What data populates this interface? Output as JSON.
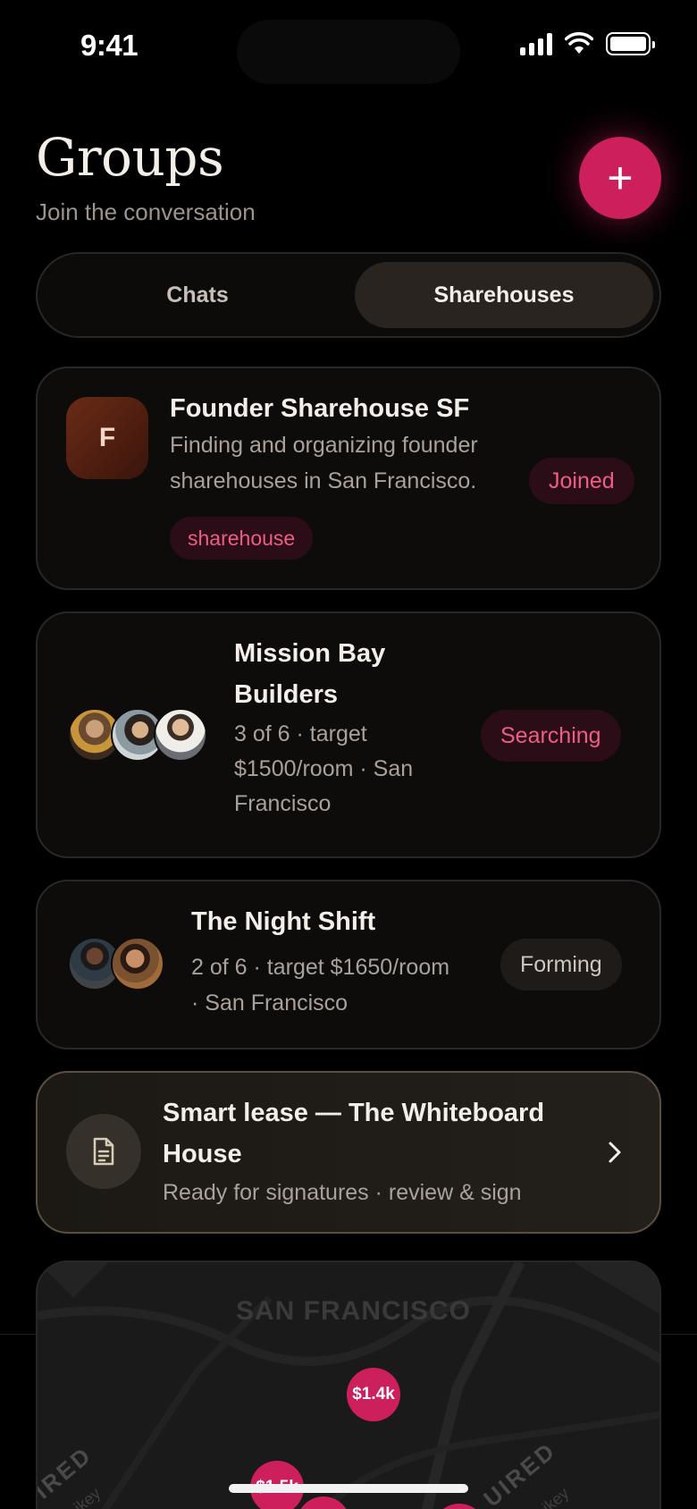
{
  "status_bar": {
    "time": "9:41"
  },
  "header": {
    "title": "Groups",
    "subtitle": "Join the conversation",
    "add_label": "+"
  },
  "tabs": [
    {
      "label": "Chats",
      "selected": false
    },
    {
      "label": "Sharehouses",
      "selected": true
    }
  ],
  "groups": [
    {
      "initial": "F",
      "title": "Founder Sharehouse SF",
      "description_lines": [
        "Finding and organizing founder",
        "sharehouses in San Francisco."
      ],
      "tag": "sharehouse",
      "status": "Joined"
    },
    {
      "title_lines": [
        "Mission Bay",
        "Builders"
      ],
      "detail_lines": [
        "3 of 6 · target",
        "$1500/room · San",
        "Francisco"
      ],
      "status": "Searching"
    },
    {
      "title": "The Night Shift",
      "detail_lines": [
        "2 of 6 · target $1650/room",
        "· San Francisco"
      ],
      "status": "Forming"
    }
  ],
  "lease": {
    "title_lines": [
      "Smart lease — The Whiteboard",
      "House"
    ],
    "subtitle": "Ready for signatures · review & sign"
  },
  "map": {
    "area_label": "SAN FRANCISCO",
    "pins": [
      "$1.4k",
      "$1.5k"
    ],
    "left_text": "IRED",
    "left_small": "ikey",
    "right_text": "UIRED",
    "right_small": "ikey"
  },
  "colors": {
    "accent": "#cc1f5c",
    "pink_text": "#ef5d84",
    "background": "#000000",
    "card": "#0e0c0b"
  },
  "icons": [
    "signal-icon",
    "wifi-icon",
    "battery-icon",
    "plus-icon",
    "document-icon",
    "chevron-right-icon"
  ]
}
